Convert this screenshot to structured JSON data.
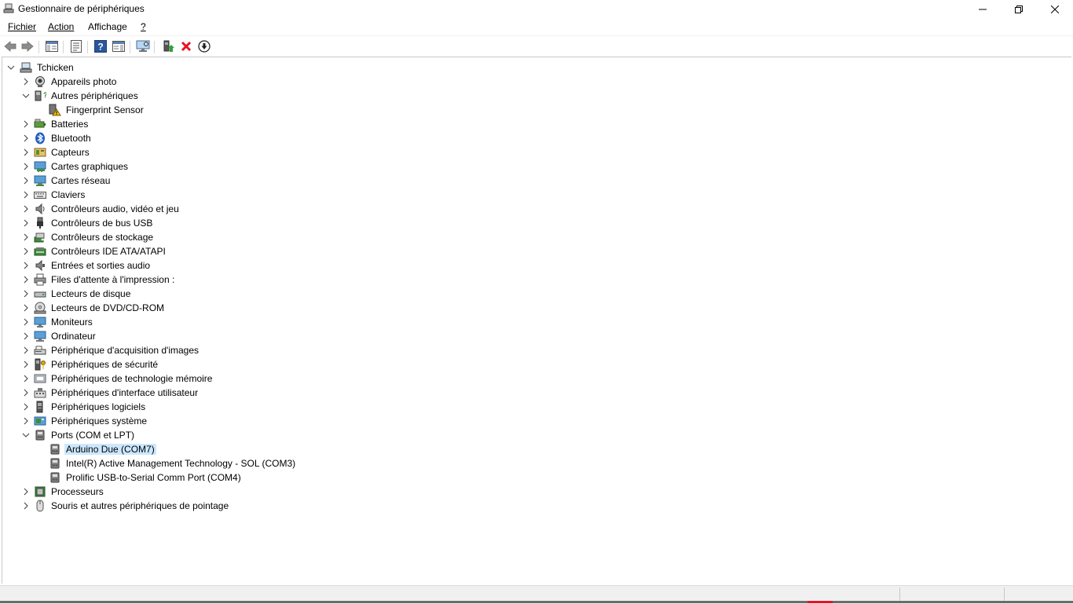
{
  "window": {
    "title": "Gestionnaire de périphériques",
    "icon": "device-manager-icon",
    "controls": [
      "minimize-icon",
      "restore-icon",
      "close-icon"
    ]
  },
  "menu": {
    "items": [
      {
        "label": "Fichier"
      },
      {
        "label": "Action"
      },
      {
        "label": "Affichage"
      },
      {
        "label": "?"
      }
    ]
  },
  "toolbar": {
    "buttons": [
      "back-arrow-icon",
      "forward-arrow-icon",
      "show-hide-tree-icon",
      "properties-icon",
      "help-icon",
      "action-pane-icon",
      "scan-hardware-icon",
      "update-driver-icon",
      "uninstall-icon",
      "disable-device-icon"
    ]
  },
  "tree": {
    "root": "Tchicken",
    "categories": [
      {
        "label": "Appareils photo",
        "icon": "camera-icon"
      },
      {
        "label": "Autres périphériques",
        "icon": "unknown-device-icon",
        "expanded": true,
        "children": [
          {
            "label": "Fingerprint Sensor",
            "icon": "warning-device-icon"
          }
        ]
      },
      {
        "label": "Batteries",
        "icon": "battery-icon"
      },
      {
        "label": "Bluetooth",
        "icon": "bluetooth-icon"
      },
      {
        "label": "Capteurs",
        "icon": "sensor-icon"
      },
      {
        "label": "Cartes graphiques",
        "icon": "display-adapter-icon"
      },
      {
        "label": "Cartes réseau",
        "icon": "network-adapter-icon"
      },
      {
        "label": "Claviers",
        "icon": "keyboard-icon"
      },
      {
        "label": "Contrôleurs audio, vidéo et jeu",
        "icon": "speaker-icon"
      },
      {
        "label": "Contrôleurs de bus USB",
        "icon": "usb-icon"
      },
      {
        "label": "Contrôleurs de stockage",
        "icon": "storage-controller-icon"
      },
      {
        "label": "Contrôleurs IDE ATA/ATAPI",
        "icon": "ide-controller-icon"
      },
      {
        "label": "Entrées et sorties audio",
        "icon": "audio-io-icon"
      },
      {
        "label": "Files d'attente à l'impression :",
        "icon": "printer-icon"
      },
      {
        "label": "Lecteurs de disque",
        "icon": "disk-drive-icon"
      },
      {
        "label": "Lecteurs de DVD/CD-ROM",
        "icon": "dvd-drive-icon"
      },
      {
        "label": "Moniteurs",
        "icon": "monitor-icon"
      },
      {
        "label": "Ordinateur",
        "icon": "computer-icon"
      },
      {
        "label": "Périphérique d'acquisition d'images",
        "icon": "scanner-icon"
      },
      {
        "label": "Périphériques de sécurité",
        "icon": "security-key-icon"
      },
      {
        "label": "Périphériques de technologie mémoire",
        "icon": "memory-tech-icon"
      },
      {
        "label": "Périphériques d'interface utilisateur",
        "icon": "hid-icon"
      },
      {
        "label": "Périphériques logiciels",
        "icon": "software-device-icon"
      },
      {
        "label": "Périphériques système",
        "icon": "system-device-icon"
      },
      {
        "label": "Ports (COM et LPT)",
        "icon": "port-icon",
        "expanded": true,
        "children": [
          {
            "label": "Arduino Due (COM7)",
            "icon": "port-icon",
            "selected": true
          },
          {
            "label": "Intel(R) Active Management Technology - SOL (COM3)",
            "icon": "port-icon"
          },
          {
            "label": "Prolific USB-to-Serial Comm Port (COM4)",
            "icon": "port-icon"
          }
        ]
      },
      {
        "label": "Processeurs",
        "icon": "processor-icon"
      },
      {
        "label": "Souris et autres périphériques de pointage",
        "icon": "mouse-icon"
      }
    ]
  },
  "colors": {
    "selection": "#cce8ff",
    "uninstall_red": "#e81123",
    "help_blue": "#2b579a"
  }
}
